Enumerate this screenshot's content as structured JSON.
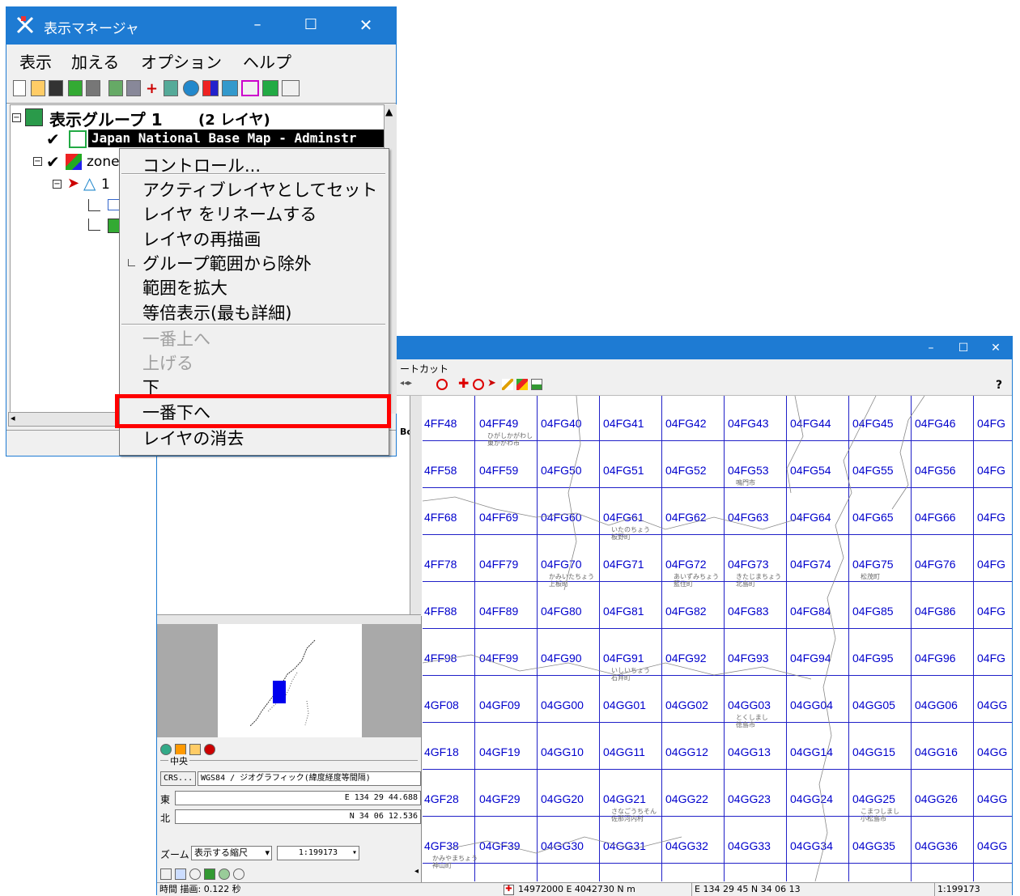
{
  "display_manager": {
    "title": "表示マネージャ",
    "menu": [
      "表示",
      "加える",
      "オプション",
      "ヘルプ"
    ],
    "tree": {
      "group_label": "表示グループ 1",
      "group_count": "(2 レイヤ)",
      "layer1": "Japan National Base Map - Adminstr",
      "layer2_prefix": "zone",
      "layer2_child_prefix": "1"
    },
    "context_menu": {
      "items": [
        {
          "label": "コントロール...",
          "disabled": false
        },
        {
          "label": "アクティブレイヤとしてセット",
          "disabled": false
        },
        {
          "label": "レイヤ をリネームする",
          "disabled": false
        },
        {
          "label": "レイヤの再描画",
          "disabled": false
        },
        {
          "label": "グループ範囲から除外",
          "disabled": false
        },
        {
          "label": "範囲を拡大",
          "disabled": false
        },
        {
          "label": "等倍表示(最も詳細)",
          "disabled": false
        },
        {
          "label": "一番上へ",
          "disabled": true
        },
        {
          "label": "上げる",
          "disabled": true
        },
        {
          "label": "下",
          "disabled": false
        },
        {
          "label": "一番下へ",
          "disabled": false
        },
        {
          "label": "レイヤの消去",
          "disabled": false
        }
      ],
      "highlighted": "一番下へ"
    }
  },
  "view_window": {
    "menu_partial": "ートカット",
    "help_icon": "?",
    "side_label": "Bo",
    "center_label": "中央",
    "crs_button": "CRS...",
    "crs_value": "WGS84 / ジオグラフィック(緯度経度等間隔)",
    "east_label": "東",
    "east_value": "E 134 29 44.688",
    "north_label": "北",
    "north_value": "N 34 06 12.536",
    "zoom_label": "ズーム",
    "zoom_mode": "表示する縮尺",
    "zoom_scale": "1:199173",
    "status_time": "時間 描画: 0.122 秒",
    "status_coords_utm": "14972000 E   4042730 N m",
    "status_coords_geo": "E 134 29 45   N 34 06 13",
    "status_scale": "1:199173",
    "grid_rows": [
      [
        "4FF48",
        "04FF49",
        "04FG40",
        "04FG41",
        "04FG42",
        "04FG43",
        "04FG44",
        "04FG45",
        "04FG46",
        "04FG"
      ],
      [
        "4FF58",
        "04FF59",
        "04FG50",
        "04FG51",
        "04FG52",
        "04FG53",
        "04FG54",
        "04FG55",
        "04FG56",
        "04FG"
      ],
      [
        "4FF68",
        "04FF69",
        "04FG60",
        "04FG61",
        "04FG62",
        "04FG63",
        "04FG64",
        "04FG65",
        "04FG66",
        "04FG"
      ],
      [
        "4FF78",
        "04FF79",
        "04FG70",
        "04FG71",
        "04FG72",
        "04FG73",
        "04FG74",
        "04FG75",
        "04FG76",
        "04FG"
      ],
      [
        "4FF88",
        "04FF89",
        "04FG80",
        "04FG81",
        "04FG82",
        "04FG83",
        "04FG84",
        "04FG85",
        "04FG86",
        "04FG"
      ],
      [
        "4FF98",
        "04FF99",
        "04FG90",
        "04FG91",
        "04FG92",
        "04FG93",
        "04FG94",
        "04FG95",
        "04FG96",
        "04FG"
      ],
      [
        "4GF08",
        "04GF09",
        "04GG00",
        "04GG01",
        "04GG02",
        "04GG03",
        "04GG04",
        "04GG05",
        "04GG06",
        "04GG"
      ],
      [
        "4GF18",
        "04GF19",
        "04GG10",
        "04GG11",
        "04GG12",
        "04GG13",
        "04GG14",
        "04GG15",
        "04GG16",
        "04GG"
      ],
      [
        "4GF28",
        "04GF29",
        "04GG20",
        "04GG21",
        "04GG22",
        "04GG23",
        "04GG24",
        "04GG25",
        "04GG26",
        "04GG"
      ],
      [
        "4GF38",
        "04GF39",
        "04GG30",
        "04GG31",
        "04GG32",
        "04GG33",
        "04GG34",
        "04GG35",
        "04GG36",
        "04GG"
      ]
    ],
    "place_labels": [
      {
        "text": "ひがしかがわし",
        "row": 0,
        "col": 1
      },
      {
        "text": "東かがわ市",
        "row": 0,
        "col": 1
      },
      {
        "text": "鳴門市",
        "row": 1,
        "col": 5
      },
      {
        "text": "いたのちょう",
        "row": 2,
        "col": 3
      },
      {
        "text": "板野町",
        "row": 2,
        "col": 3
      },
      {
        "text": "かみいたちょう",
        "row": 3,
        "col": 2
      },
      {
        "text": "上板町",
        "row": 3,
        "col": 2
      },
      {
        "text": "あいずみちょう",
        "row": 3,
        "col": 4
      },
      {
        "text": "藍住町",
        "row": 3,
        "col": 4
      },
      {
        "text": "きたじまちょう",
        "row": 3,
        "col": 5
      },
      {
        "text": "北島町",
        "row": 3,
        "col": 5
      },
      {
        "text": "松茂町",
        "row": 3,
        "col": 7
      },
      {
        "text": "いしいちょう",
        "row": 5,
        "col": 3
      },
      {
        "text": "石井町",
        "row": 5,
        "col": 3
      },
      {
        "text": "とくしまし",
        "row": 6,
        "col": 5
      },
      {
        "text": "徳島市",
        "row": 6,
        "col": 5
      },
      {
        "text": "さなごうちそん",
        "row": 8,
        "col": 3
      },
      {
        "text": "佐那河内村",
        "row": 8,
        "col": 3
      },
      {
        "text": "こまつしまし",
        "row": 8,
        "col": 7
      },
      {
        "text": "小松島市",
        "row": 8,
        "col": 7
      },
      {
        "text": "かみやまちょう",
        "row": 9,
        "col": 0
      },
      {
        "text": "神山町",
        "row": 9,
        "col": 0
      }
    ]
  }
}
